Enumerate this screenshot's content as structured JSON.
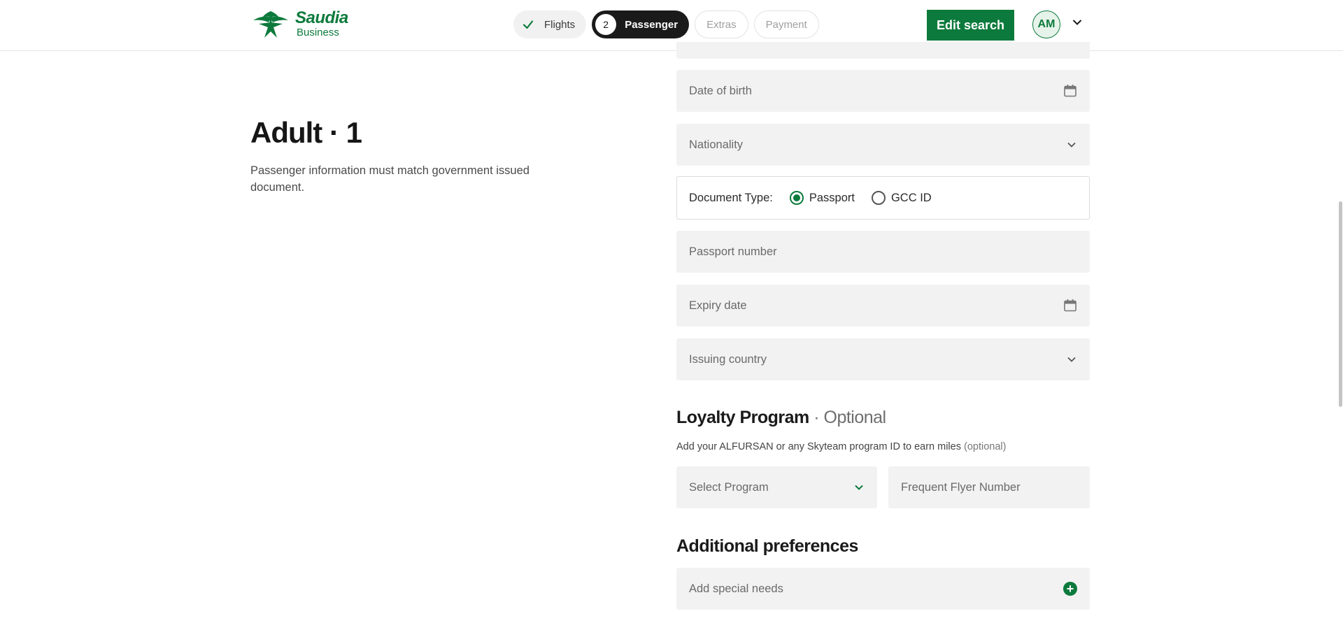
{
  "brand": {
    "name": "Saudia",
    "sub": "Business"
  },
  "steps": [
    {
      "label": "Flights",
      "state": "done"
    },
    {
      "num": "2",
      "label": "Passenger",
      "state": "current"
    },
    {
      "label": "Extras",
      "state": "todo"
    },
    {
      "label": "Payment",
      "state": "todo"
    }
  ],
  "header": {
    "edit_label": "Edit search",
    "avatar_initials": "AM"
  },
  "passenger": {
    "title": "Adult · 1",
    "note": "Passenger information must match government issued document."
  },
  "form": {
    "dob_placeholder": "Date of birth",
    "nationality_placeholder": "Nationality",
    "doc_type_label": "Document Type:",
    "doc_options": [
      "Passport",
      "GCC ID"
    ],
    "doc_selected": "Passport",
    "passport_placeholder": "Passport number",
    "expiry_placeholder": "Expiry date",
    "issuing_placeholder": "Issuing country"
  },
  "loyalty": {
    "title": "Loyalty Program",
    "optional": " · Optional",
    "desc": "Add your ALFURSAN or any Skyteam program ID to earn miles",
    "desc_optional": "(optional)",
    "program_placeholder": "Select Program",
    "ffn_placeholder": "Frequent Flyer Number"
  },
  "preferences": {
    "title": "Additional preferences",
    "special_needs": "Add special needs"
  },
  "colors": {
    "brand_green": "#0c7a3c",
    "field_bg": "#f2f2f2",
    "dark": "#1a1a1a"
  }
}
